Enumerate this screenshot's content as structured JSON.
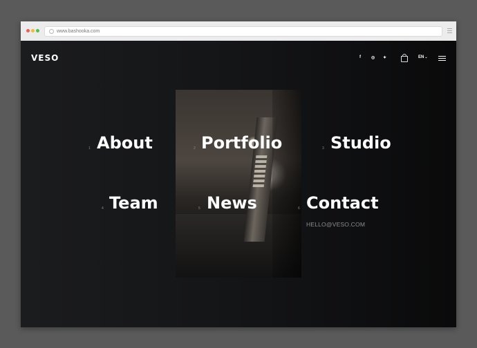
{
  "browser": {
    "url": "www.bashooka.com"
  },
  "site": {
    "logo": "VESO",
    "social": [
      {
        "icon": "facebook-icon",
        "glyph": "f"
      },
      {
        "icon": "instagram-icon",
        "glyph": "◎"
      },
      {
        "icon": "twitter-icon",
        "glyph": "✦"
      }
    ],
    "cart_icon": "shopping-bag-icon",
    "language": "EN",
    "menu_icon": "hamburger-menu-icon"
  },
  "menu": {
    "items": [
      {
        "num": "1",
        "label": "About"
      },
      {
        "num": "2",
        "label": "Portfolio"
      },
      {
        "num": "3",
        "label": "Studio"
      },
      {
        "num": "4",
        "label": "Team"
      },
      {
        "num": "5",
        "label": "News"
      },
      {
        "num": "6",
        "label": "Contact"
      }
    ],
    "email": "HELLO@VESO.COM"
  }
}
